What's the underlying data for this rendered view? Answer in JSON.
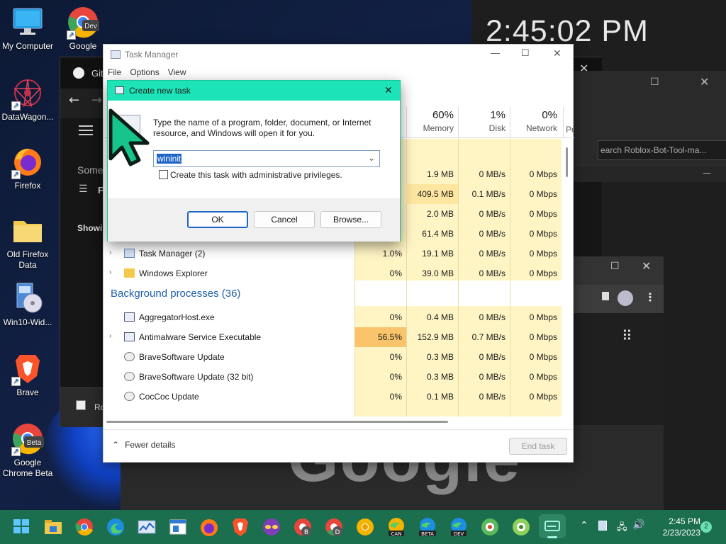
{
  "desktop": {
    "clock": "2:45:02 PM",
    "icons": [
      {
        "label": "My Computer",
        "icon": "monitor-icon"
      },
      {
        "label": "Google Chrome Dev",
        "visible_label": "Google",
        "badge": "Dev",
        "icon": "chrome-dev-icon"
      },
      {
        "label": "DataWagon...",
        "icon": "datawagon-icon"
      },
      {
        "label": "Firefox",
        "icon": "firefox-icon"
      },
      {
        "label": "Old Firefox Data",
        "line1": "Old Firefox",
        "line2": "Data",
        "icon": "folder-icon"
      },
      {
        "label": "Win10-Wid...",
        "icon": "installer-icon"
      },
      {
        "label": "Brave",
        "icon": "brave-icon"
      },
      {
        "label": "Google Chrome Beta",
        "line1": "Google",
        "line2": "Chrome Beta",
        "badge": "Beta",
        "icon": "chrome-beta-icon"
      }
    ]
  },
  "background_windows": {
    "github_title": "Git",
    "some_text": "Some",
    "filter_label": "F",
    "showing_text": "Showin",
    "search_text": "earch Roblox-Bot-Tool-ma...",
    "bottom_bar_text": "Ro",
    "google_logo": "Google"
  },
  "task_manager": {
    "title": "Task Manager",
    "menu": [
      "File",
      "Options",
      "View"
    ],
    "columns": [
      {
        "pct": "60%",
        "label": "Memory"
      },
      {
        "pct": "1%",
        "label": "Disk"
      },
      {
        "pct": "0%",
        "label": "Network"
      },
      {
        "pct": "",
        "label": "Po"
      }
    ],
    "top_rows": [
      {
        "mem": "1.9 MB",
        "disk": "0 MB/s",
        "net": "0 Mbps"
      },
      {
        "mem": "409.5 MB",
        "disk": "0.1 MB/s",
        "net": "0 Mbps"
      },
      {
        "mem": "2.0 MB",
        "disk": "0 MB/s",
        "net": "0 Mbps"
      },
      {
        "mem": "61.4 MB",
        "disk": "0 MB/s",
        "net": "0 Mbps"
      }
    ],
    "app_rows": [
      {
        "name": "Task Manager (2)",
        "cpu": "1.0%",
        "mem": "19.1 MB",
        "disk": "0 MB/s",
        "net": "0 Mbps",
        "expand": true
      },
      {
        "name": "Windows Explorer",
        "cpu": "0%",
        "mem": "39.0 MB",
        "disk": "0 MB/s",
        "net": "0 Mbps",
        "expand": true
      }
    ],
    "background_header": "Background processes (36)",
    "bg_rows": [
      {
        "name": "AggregatorHost.exe",
        "cpu": "0%",
        "mem": "0.4 MB",
        "disk": "0 MB/s",
        "net": "0 Mbps",
        "expand": false
      },
      {
        "name": "Antimalware Service Executable",
        "cpu": "56.5%",
        "mem": "152.9 MB",
        "disk": "0.7 MB/s",
        "net": "0 Mbps",
        "expand": true
      },
      {
        "name": "BraveSoftware Update",
        "cpu": "0%",
        "mem": "0.3 MB",
        "disk": "0 MB/s",
        "net": "0 Mbps",
        "expand": false
      },
      {
        "name": "BraveSoftware Update (32 bit)",
        "cpu": "0%",
        "mem": "0.3 MB",
        "disk": "0 MB/s",
        "net": "0 Mbps",
        "expand": false
      },
      {
        "name": "CocCoc Update",
        "cpu": "0%",
        "mem": "0.1 MB",
        "disk": "0 MB/s",
        "net": "0 Mbps",
        "expand": false
      }
    ],
    "fewer_details": "Fewer details",
    "end_task": "End task"
  },
  "dialog": {
    "title": "Create new task",
    "message": "Type the name of a program, folder, document, or Internet resource, and Windows will open it for you.",
    "input_value": "wininit",
    "admin_label": "Create this task with administrative privileges.",
    "admin_checked": false,
    "ok": "OK",
    "cancel": "Cancel",
    "browse": "Browse..."
  },
  "taskbar": {
    "icons": [
      "start-icon",
      "file-explorer-icon",
      "chrome-icon",
      "edge-icon",
      "task-manager-icon",
      "app-window-icon",
      "firefox-icon",
      "brave-icon",
      "tor-icon",
      "brave-beta-icon",
      "chrome-dev-icon",
      "chrome-canary-icon",
      "edge-can-icon",
      "edge-beta-icon",
      "edge-dev-icon",
      "coccoc-icon",
      "browser-icon",
      "active-app-icon"
    ],
    "badges": {
      "edge_can": "CAN",
      "edge_beta": "BETA",
      "edge_dev": "DEV"
    },
    "time": "2:45 PM",
    "date": "2/23/2023",
    "notifications": "2"
  },
  "colors": {
    "taskbar": "#1b6e4e",
    "dialog_title": "#1de3b8",
    "cpu_highlight": "#f9c46b",
    "data_cell": "#fff4c4"
  }
}
